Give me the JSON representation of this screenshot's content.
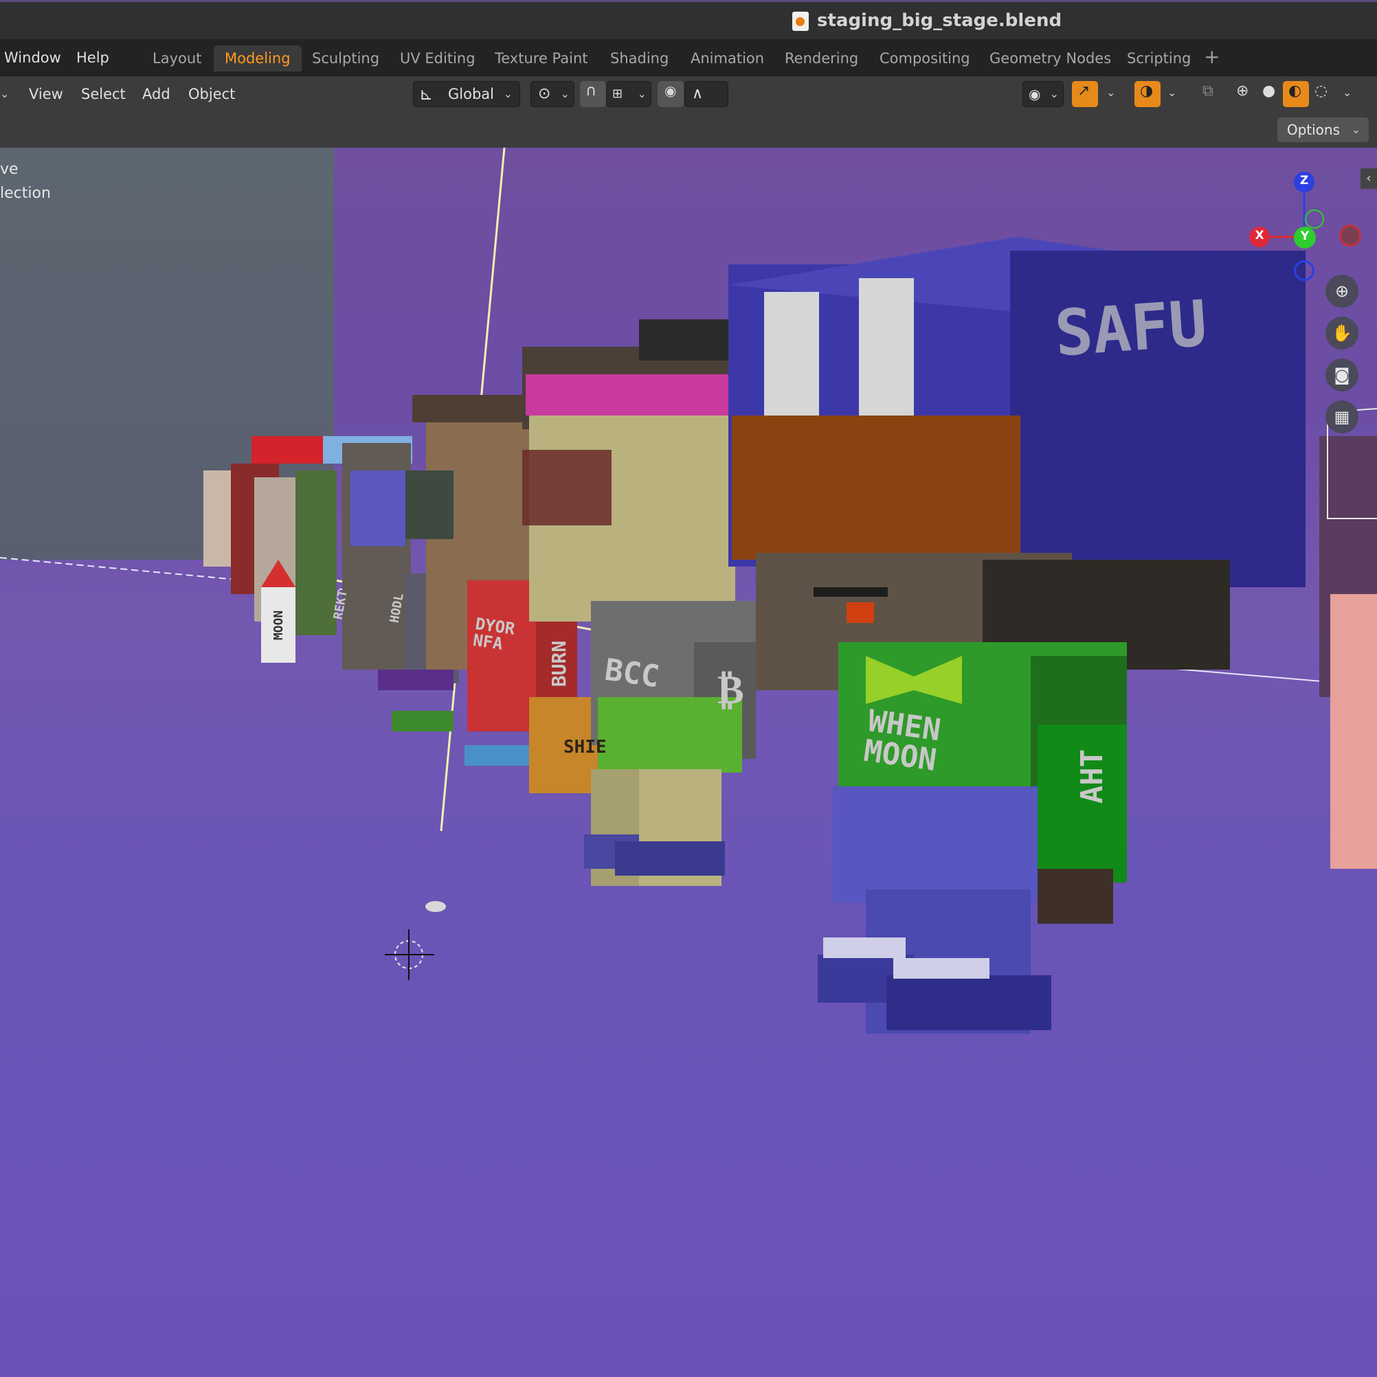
{
  "window": {
    "title": "staging_big_stage.blend"
  },
  "menu": {
    "window": "Window",
    "help": "Help"
  },
  "workspace_tabs": [
    {
      "label": "Layout"
    },
    {
      "label": "Modeling",
      "active": true
    },
    {
      "label": "Sculpting"
    },
    {
      "label": "UV Editing"
    },
    {
      "label": "Texture Paint"
    },
    {
      "label": "Shading"
    },
    {
      "label": "Animation"
    },
    {
      "label": "Rendering"
    },
    {
      "label": "Compositing"
    },
    {
      "label": "Geometry Nodes"
    },
    {
      "label": "Scripting"
    }
  ],
  "header": {
    "view": "View",
    "select": "Select",
    "add": "Add",
    "object": "Object",
    "orientation": "Global",
    "options": "Options"
  },
  "overlay_text": {
    "line1": "ve",
    "line2": "lection"
  },
  "gizmo": {
    "z": "Z",
    "x": "X",
    "y": "Y"
  },
  "scene_labels": {
    "cap": "SAFU",
    "shirt": "WHEN\nMOON",
    "sleeve": "AHT",
    "shirt2": "BCC",
    "btc": "₿",
    "dyor": "DYOR\nNFA",
    "burn": "BURN",
    "shib": "SHIE",
    "moon": "MOON",
    "hodl": "HODL",
    "rekt": "REKT"
  },
  "colors": {
    "accent": "#ff9a1c",
    "active_button": "#e88a1a"
  }
}
